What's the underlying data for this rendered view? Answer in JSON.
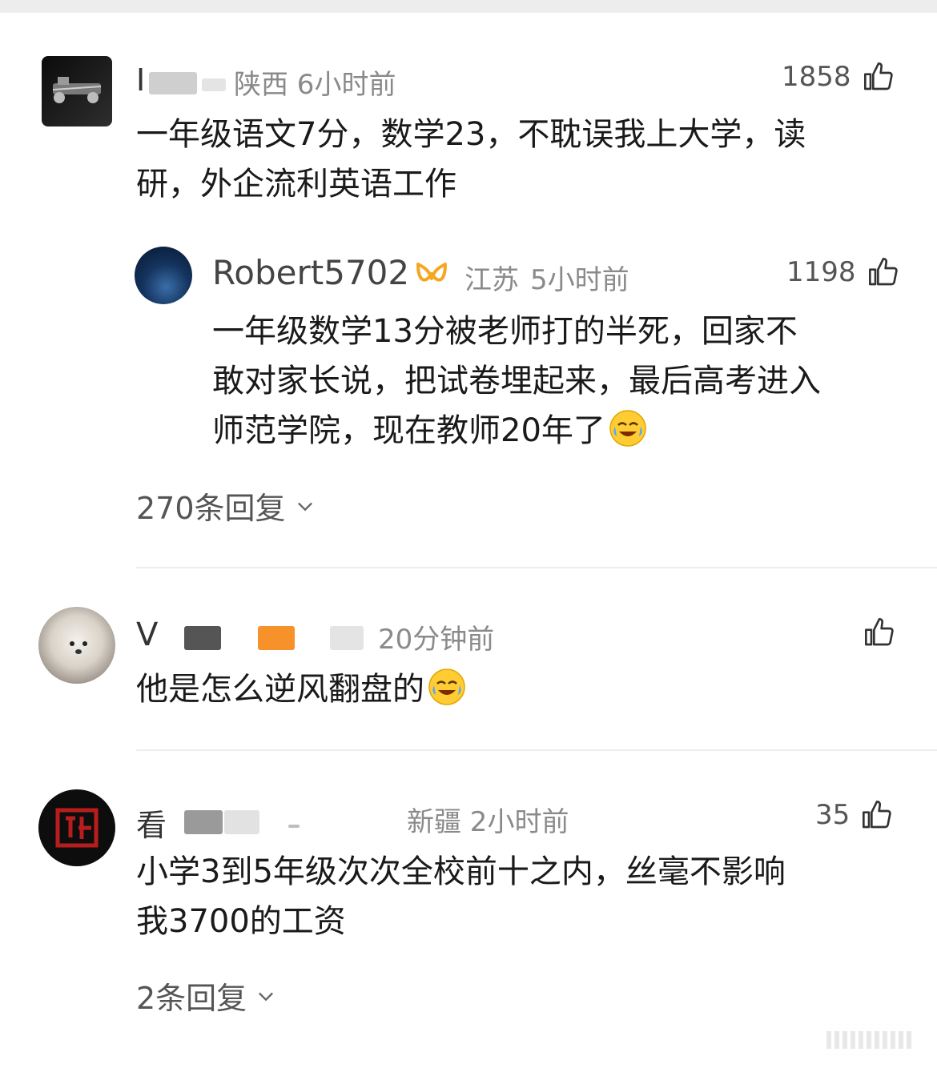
{
  "comments": [
    {
      "name_visible": "I",
      "location_time": "陕西 6小时前",
      "likes": "1858",
      "text_lines": [
        "一年级语文7分，数学23，不耽误我上大学，读",
        "研，外企流利英语工作"
      ]
    },
    {
      "name_visible": "V",
      "location_time": "20分钟前",
      "likes": "",
      "text_lines": [
        "他是怎么逆风翻盘的"
      ]
    },
    {
      "name_visible": "看",
      "location_time": "新疆 2小时前",
      "likes": "35",
      "text_lines": [
        "小学3到5年级次次全校前十之内，丝毫不影响",
        "我3700的工资"
      ],
      "replies": "2条回复"
    }
  ],
  "reply": {
    "username": "Robert5702",
    "location": "江苏",
    "time": "5小时前",
    "likes": "1198",
    "text_lines": [
      "一年级数学13分被老师打的半死，回家不",
      "敢对家长说，把试卷埋起来，最后高考进入",
      "师范学院，现在教师20年了"
    ],
    "badge_color": "#f5a623"
  },
  "reply_count": "270条回复",
  "icons": {
    "like": "thumbs-up-icon",
    "chevron": "chevron-down-icon",
    "emoji": "crying-laughing-emoji"
  }
}
